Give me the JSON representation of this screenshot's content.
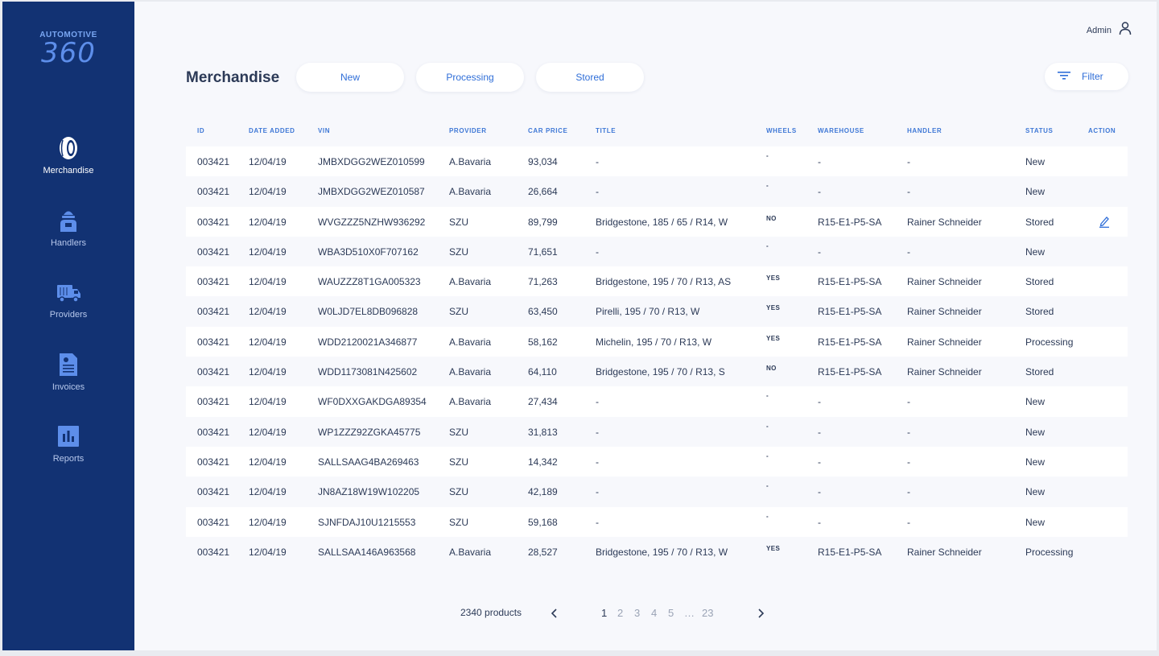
{
  "brand": {
    "small": "AUTOMOTIVE",
    "big": "360"
  },
  "nav": [
    {
      "label": "Merchandise",
      "icon": "tire-icon",
      "active": true
    },
    {
      "label": "Handlers",
      "icon": "handler-icon"
    },
    {
      "label": "Providers",
      "icon": "truck-icon"
    },
    {
      "label": "Invoices",
      "icon": "invoice-icon"
    },
    {
      "label": "Reports",
      "icon": "report-chart-icon"
    }
  ],
  "user": {
    "label": "Admin",
    "icon": "user-icon"
  },
  "page": {
    "title": "Merchandise"
  },
  "tabs": [
    {
      "label": "New"
    },
    {
      "label": "Processing"
    },
    {
      "label": "Stored"
    }
  ],
  "filter": {
    "label": "Filter",
    "icon": "filter-icon"
  },
  "table": {
    "headers": [
      "ID",
      "DATE ADDED",
      "VIN",
      "PROVIDER",
      "CAR PRICE",
      "TITLE",
      "WHEELS",
      "WAREHOUSE",
      "HANDLER",
      "STATUS",
      "ACTION"
    ],
    "rows": [
      [
        "003421",
        "12/04/19",
        "JMBXDGG2WEZ010599",
        "A.Bavaria",
        "93,034",
        "-",
        "-",
        "-",
        "-",
        "New"
      ],
      [
        "003421",
        "12/04/19",
        "JMBXDGG2WEZ010587",
        "A.Bavaria",
        "26,664",
        "-",
        "-",
        "-",
        "-",
        "New"
      ],
      [
        "003421",
        "12/04/19",
        "WVGZZZ5NZHW936292",
        "SZU",
        "89,799",
        "Bridgestone, 185 / 65 / R14, W",
        "NO",
        "R15-E1-P5-SA",
        "Rainer Schneider",
        "Stored"
      ],
      [
        "003421",
        "12/04/19",
        "WBA3D510X0F707162",
        "SZU",
        "71,651",
        "-",
        "-",
        "-",
        "-",
        "New"
      ],
      [
        "003421",
        "12/04/19",
        "WAUZZZ8T1GA005323",
        "A.Bavaria",
        "71,263",
        "Bridgestone, 195 / 70 / R13, AS",
        "YES",
        "R15-E1-P5-SA",
        "Rainer Schneider",
        "Stored"
      ],
      [
        "003421",
        "12/04/19",
        "W0LJD7EL8DB096828",
        "SZU",
        "63,450",
        "Pirelli, 195 / 70 / R13, W",
        "YES",
        "R15-E1-P5-SA",
        "Rainer Schneider",
        "Stored"
      ],
      [
        "003421",
        "12/04/19",
        "WDD2120021A346877",
        "A.Bavaria",
        "58,162",
        "Michelin, 195 / 70 / R13, W",
        "YES",
        "R15-E1-P5-SA",
        "Rainer Schneider",
        "Processing"
      ],
      [
        "003421",
        "12/04/19",
        "WDD1173081N425602",
        "A.Bavaria",
        "64,110",
        "Bridgestone, 195 / 70 / R13, S",
        "NO",
        "R15-E1-P5-SA",
        "Rainer Schneider",
        "Stored"
      ],
      [
        "003421",
        "12/04/19",
        "WF0DXXGAKDGA89354",
        "A.Bavaria",
        "27,434",
        "-",
        "-",
        "-",
        "-",
        "New"
      ],
      [
        "003421",
        "12/04/19",
        "WP1ZZZ92ZGKA45775",
        "SZU",
        "31,813",
        "-",
        "-",
        "-",
        "-",
        "New"
      ],
      [
        "003421",
        "12/04/19",
        "SALLSAAG4BA269463",
        "SZU",
        "14,342",
        "-",
        "-",
        "-",
        "-",
        "New"
      ],
      [
        "003421",
        "12/04/19",
        "JN8AZ18W19W102205",
        "SZU",
        "42,189",
        "-",
        "-",
        "-",
        "-",
        "New"
      ],
      [
        "003421",
        "12/04/19",
        "SJNFDAJ10U1215553",
        "SZU",
        "59,168",
        "-",
        "-",
        "-",
        "-",
        "New"
      ],
      [
        "003421",
        "12/04/19",
        "SALLSAA146A963568",
        "A.Bavaria",
        "28,527",
        "Bridgestone, 195 / 70 / R13, W",
        "YES",
        "R15-E1-P5-SA",
        "Rainer Schneider",
        "Processing"
      ]
    ],
    "action_row": 2,
    "action_icon": "edit-pencil-icon"
  },
  "pagination": {
    "count_label": "2340 products",
    "pages": [
      "1",
      "2",
      "3",
      "4",
      "5",
      "…",
      "23"
    ],
    "current": "1",
    "prev_icon": "chevron-left-icon",
    "next_icon": "chevron-right-icon"
  },
  "colors": {
    "sidebar": "#123273",
    "accent": "#2f6ed8",
    "text": "#2c3a57",
    "background": "#f7f8fc"
  }
}
